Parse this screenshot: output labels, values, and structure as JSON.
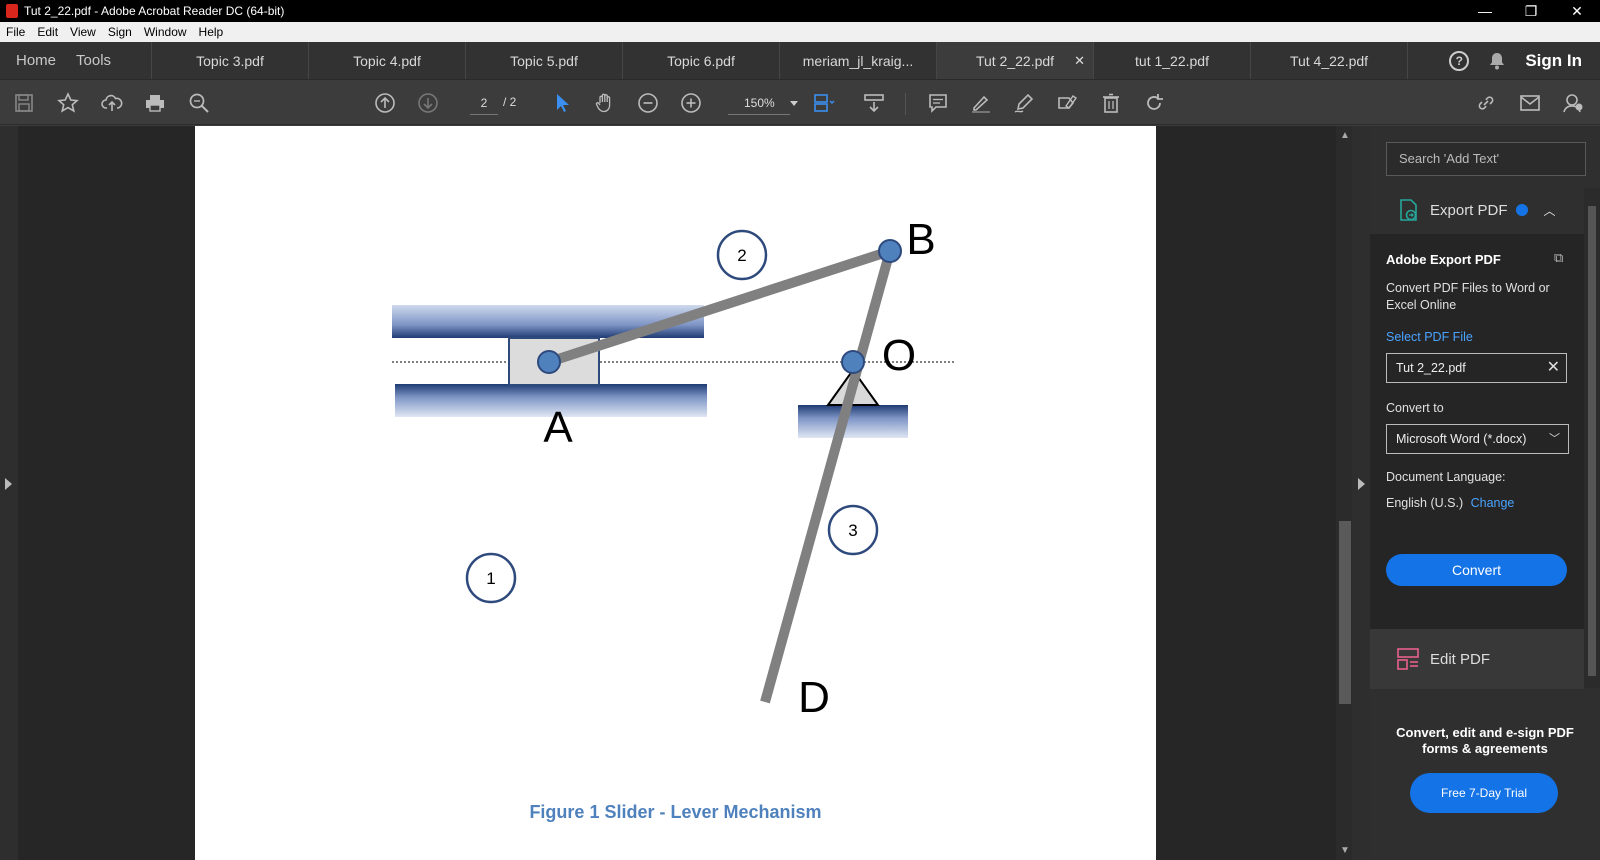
{
  "window": {
    "title": "Tut 2_22.pdf - Adobe Acrobat Reader DC (64-bit)",
    "minimize": "—",
    "restore": "❐",
    "close": "✕"
  },
  "menu": [
    "File",
    "Edit",
    "View",
    "Sign",
    "Window",
    "Help"
  ],
  "nav": {
    "home": "Home",
    "tools": "Tools"
  },
  "tabs": [
    {
      "label": "Topic 3.pdf"
    },
    {
      "label": "Topic 4.pdf"
    },
    {
      "label": "Topic 5.pdf"
    },
    {
      "label": "Topic 6.pdf"
    },
    {
      "label": "meriam_jl_kraig..."
    },
    {
      "label": "Tut 2_22.pdf",
      "active": true
    },
    {
      "label": "tut 1_22.pdf"
    },
    {
      "label": "Tut 4_22.pdf"
    }
  ],
  "tab_close": "✕",
  "header_right": {
    "help": "?",
    "sign_in": "Sign In"
  },
  "toolbar": {
    "page_current": "2",
    "page_total": "/ 2",
    "zoom": "150%"
  },
  "document": {
    "labels": {
      "A": "A",
      "B": "B",
      "O": "O",
      "D": "D"
    },
    "link_numbers": {
      "1": "1",
      "2": "2",
      "3": "3"
    },
    "caption": "Figure 1 Slider - Lever Mechanism"
  },
  "right_panel": {
    "search_placeholder": "Search 'Add Text'",
    "export_header": "Export PDF",
    "export_title": "Adobe Export PDF",
    "export_desc": "Convert PDF Files to Word or Excel Online",
    "select_file_link": "Select PDF File",
    "file_name": "Tut 2_22.pdf",
    "convert_to_label": "Convert to",
    "convert_to_value": "Microsoft Word (*.docx)",
    "doc_language_label": "Document Language:",
    "doc_language_value": "English (U.S.)",
    "change_link": "Change",
    "convert_button": "Convert",
    "edit_pdf": "Edit PDF",
    "promo_text": "Convert, edit and e-sign PDF forms & agreements",
    "trial_button": "Free 7-Day Trial"
  },
  "colors": {
    "accent": "#1473e6",
    "caption": "#4f81bd",
    "joint": "#4f81bd",
    "link": "#808080"
  }
}
